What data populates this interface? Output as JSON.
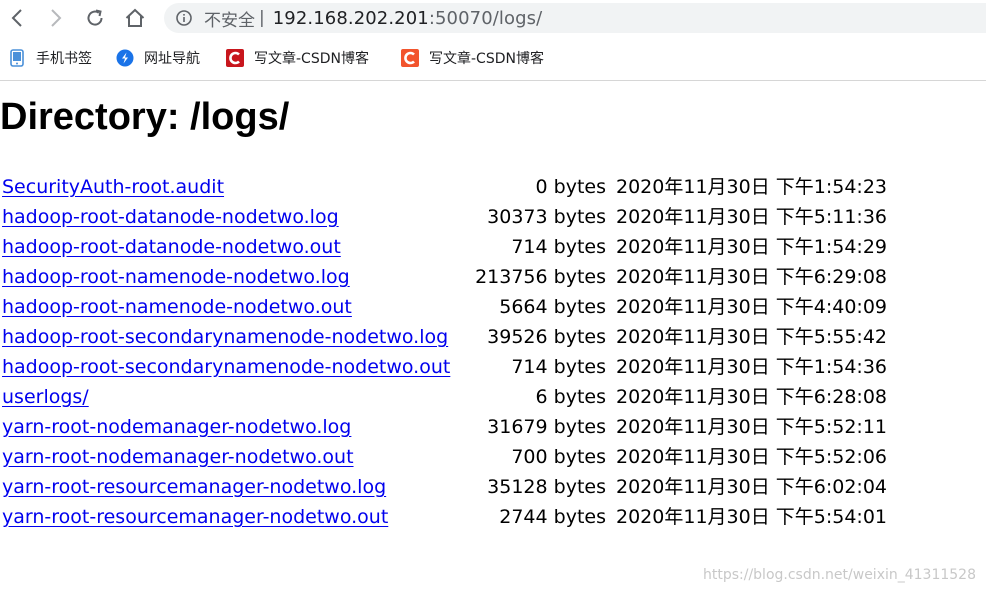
{
  "browser": {
    "security_label": "不安全",
    "separator": "|",
    "url_host": "192.168.202.201",
    "url_rest": ":50070/logs/"
  },
  "bookmarks": [
    {
      "label": "手机书签",
      "icon": "mobile-bookmark-icon",
      "color": "#4a90d9"
    },
    {
      "label": "网址导航",
      "icon": "navigation-icon",
      "color": "#1a73e8"
    },
    {
      "label": "写文章-CSDN博客",
      "icon": "csdn-icon",
      "color": "#c8161d"
    },
    {
      "label": "写文章-CSDN博客",
      "icon": "csdn-icon",
      "color": "#f2542d"
    }
  ],
  "page": {
    "title": "Directory: /logs/"
  },
  "files": [
    {
      "name": "SecurityAuth-root.audit",
      "size": "0 bytes",
      "date": "2020年11月30日 下午1:54:23"
    },
    {
      "name": "hadoop-root-datanode-nodetwo.log",
      "size": "30373 bytes",
      "date": "2020年11月30日 下午5:11:36"
    },
    {
      "name": "hadoop-root-datanode-nodetwo.out",
      "size": "714 bytes",
      "date": "2020年11月30日 下午1:54:29"
    },
    {
      "name": "hadoop-root-namenode-nodetwo.log",
      "size": "213756 bytes",
      "date": "2020年11月30日 下午6:29:08"
    },
    {
      "name": "hadoop-root-namenode-nodetwo.out",
      "size": "5664 bytes",
      "date": "2020年11月30日 下午4:40:09"
    },
    {
      "name": "hadoop-root-secondarynamenode-nodetwo.log",
      "size": "39526 bytes",
      "date": "2020年11月30日 下午5:55:42"
    },
    {
      "name": "hadoop-root-secondarynamenode-nodetwo.out",
      "size": "714 bytes",
      "date": "2020年11月30日 下午1:54:36"
    },
    {
      "name": "userlogs/",
      "size": "6 bytes",
      "date": "2020年11月30日 下午6:28:08"
    },
    {
      "name": "yarn-root-nodemanager-nodetwo.log",
      "size": "31679 bytes",
      "date": "2020年11月30日 下午5:52:11"
    },
    {
      "name": "yarn-root-nodemanager-nodetwo.out",
      "size": "700 bytes",
      "date": "2020年11月30日 下午5:52:06"
    },
    {
      "name": "yarn-root-resourcemanager-nodetwo.log",
      "size": "35128 bytes",
      "date": "2020年11月30日 下午6:02:04"
    },
    {
      "name": "yarn-root-resourcemanager-nodetwo.out",
      "size": "2744 bytes",
      "date": "2020年11月30日 下午5:54:01"
    }
  ],
  "watermark": "https://blog.csdn.net/weixin_41311528",
  "colors": {
    "link": "#0000ee",
    "address_bar_bg": "#f1f3f4",
    "chrome_icon": "#5f6368"
  }
}
